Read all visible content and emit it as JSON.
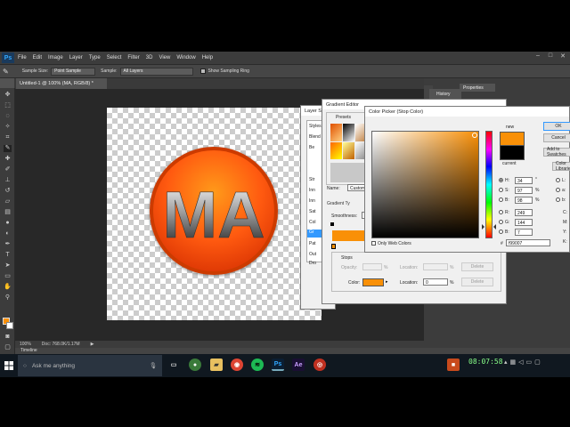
{
  "menu": {
    "logo": "Ps",
    "items": [
      "File",
      "Edit",
      "Image",
      "Layer",
      "Type",
      "Select",
      "Filter",
      "3D",
      "View",
      "Window",
      "Help"
    ]
  },
  "options": {
    "sample_size_label": "Sample Size:",
    "sample_size_value": "Point Sample",
    "sample_label": "Sample:",
    "sample_value": "All Layers",
    "show_ring_label": "Show Sampling Ring"
  },
  "document": {
    "tab_title": "Untitled-1 @ 100% (MA, RGB/8) *",
    "logo_text": "MA",
    "zoom": "100%",
    "doc_size": "Doc: 768.0K/1.17M"
  },
  "panels": {
    "history": "History",
    "properties": "Properties",
    "timeline": "Timeline"
  },
  "layer_style": {
    "title": "Layer St",
    "items": [
      "Styles",
      "Blend",
      "Be",
      "",
      "Str",
      "Inn",
      "Inn",
      "Sat",
      "Col",
      "Gr",
      "Pat",
      "Out",
      "Dro"
    ]
  },
  "gradient_editor": {
    "title": "Gradient Editor",
    "presets_label": "Presets",
    "name_label": "Name:",
    "name_value": "Custom",
    "gradient_type_label": "Gradient Ty",
    "smoothness_label": "Smoothness:",
    "smoothness_value": "1",
    "stops_label": "Stops",
    "opacity_label": "Opacity:",
    "location_label": "Location:",
    "percent": "%",
    "delete_label": "Delete",
    "color_label": "Color:",
    "color_location_value": "0",
    "color_value": "#f99007"
  },
  "color_picker": {
    "title": "Color Picker (Stop Color)",
    "new_label": "new",
    "current_label": "current",
    "buttons": [
      "OK",
      "Cancel",
      "Add to Swatches",
      "Color Libraries"
    ],
    "only_web_colors": "Only Web Colors",
    "hsb": [
      {
        "label": "H:",
        "value": "34",
        "unit": "°"
      },
      {
        "label": "S:",
        "value": "97",
        "unit": "%"
      },
      {
        "label": "B:",
        "value": "98",
        "unit": "%"
      }
    ],
    "rgb": [
      {
        "label": "R:",
        "value": "249"
      },
      {
        "label": "G:",
        "value": "144"
      },
      {
        "label": "B:",
        "value": "7"
      }
    ],
    "lab_labels": [
      "L:",
      "a:",
      "b:"
    ],
    "cmyk_labels": [
      "C:",
      "M:",
      "Y:",
      "K:"
    ],
    "hex_label": "#",
    "hex_value": "f99007",
    "new_color": "#f99007",
    "current_color": "#000000"
  },
  "taskbar": {
    "search_placeholder": "Ask me anything",
    "apps": [
      "Ps",
      "Ae"
    ],
    "clock": "08:07:58"
  }
}
